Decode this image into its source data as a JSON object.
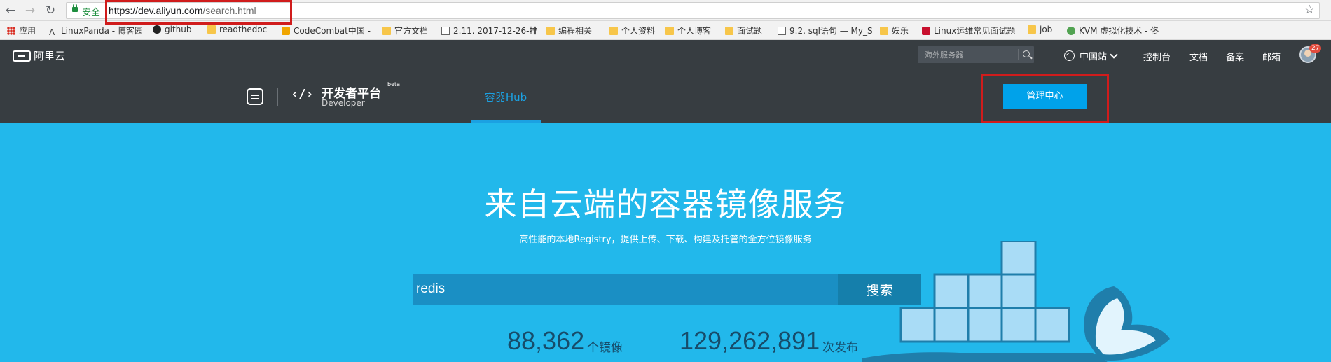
{
  "browser": {
    "secure_label": "安全",
    "url_host": "https://dev.aliyun.com",
    "url_path": "/search.html"
  },
  "bookmarks": [
    {
      "label": "应用",
      "icon": "apps-icon"
    },
    {
      "label": "LinuxPanda - 博客园",
      "icon": "linux-icon"
    },
    {
      "label": "github",
      "icon": "github-icon"
    },
    {
      "label": "readthedoc",
      "icon": "folder-icon"
    },
    {
      "label": "CodeCombat中国 -",
      "icon": "codecombat-icon"
    },
    {
      "label": "官方文档",
      "icon": "folder-icon"
    },
    {
      "label": "2.11. 2017-12-26-排",
      "icon": "doc-icon"
    },
    {
      "label": "编程相关",
      "icon": "folder-icon"
    },
    {
      "label": "个人资料",
      "icon": "folder-icon"
    },
    {
      "label": "个人博客",
      "icon": "folder-icon"
    },
    {
      "label": "面试题",
      "icon": "folder-icon"
    },
    {
      "label": "9.2. sql语句 — My_S",
      "icon": "page-icon"
    },
    {
      "label": "娱乐",
      "icon": "folder-icon"
    },
    {
      "label": "Linux运维常见面试题",
      "icon": "red-c-icon"
    },
    {
      "label": "job",
      "icon": "folder-icon"
    },
    {
      "label": "KVM 虚拟化技术 - 佟",
      "icon": "kvm-icon"
    }
  ],
  "topnav": {
    "logo": "阿里云",
    "search_placeholder": "海外服务器",
    "region": "中国站",
    "links": [
      "控制台",
      "文档",
      "备案",
      "邮箱"
    ],
    "badge": "27"
  },
  "subnav": {
    "title": "开发者平台",
    "subtitle": "Developer",
    "beta": "beta",
    "tab": "容器Hub",
    "manage_button": "管理中心"
  },
  "hero": {
    "title": "来自云端的容器镜像服务",
    "subtitle": "高性能的本地Registry，提供上传、下载、构建及托管的全方位镜像服务",
    "search_value": "redis",
    "search_button": "搜索",
    "stats": [
      {
        "value": "88,362",
        "unit": "个镜像"
      },
      {
        "value": "129,262,891",
        "unit": "次发布"
      }
    ]
  },
  "colors": {
    "hero_bg": "#22b8eb",
    "nav_bg": "#373d41",
    "accent": "#00a2ea",
    "highlight": "#d01c1c"
  }
}
